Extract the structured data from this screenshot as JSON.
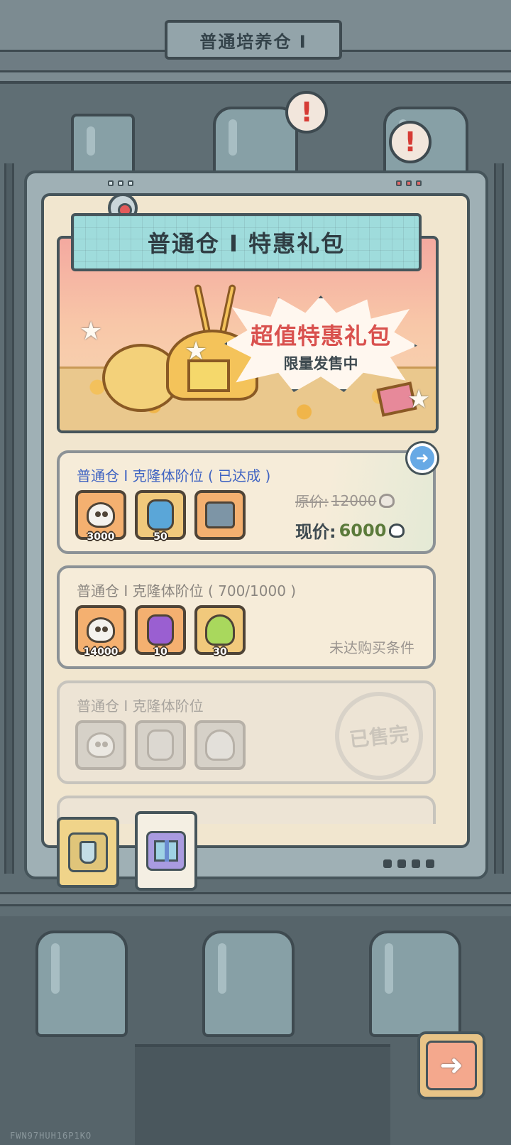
{
  "background": {
    "title": "普通培养仓 I",
    "alert_glyph": "!",
    "watermark": "FWN97HUH16P1KO"
  },
  "panel": {
    "title": "普通仓 I 特惠礼包",
    "hero": {
      "headline": "超值特惠礼包",
      "subline": "限量发售中"
    }
  },
  "packs": [
    {
      "title": "普通仓 I 克隆体阶位 ( 已达成 )",
      "state": "available",
      "items": [
        {
          "icon": "ghost-currency-icon",
          "count": "3000"
        },
        {
          "icon": "blue-potion-jar-icon",
          "count": "50"
        },
        {
          "icon": "robot-machine-icon",
          "count": ""
        }
      ],
      "original_price_label": "原价:",
      "original_price": "12000",
      "current_price_label": "现价:",
      "current_price": "6000",
      "arrow_glyph": "➜"
    },
    {
      "title": "普通仓 I 克隆体阶位 ( 700/1000 )",
      "state": "locked",
      "items": [
        {
          "icon": "ghost-currency-icon",
          "count": "14000"
        },
        {
          "icon": "purple-potion-jar-icon",
          "count": "10"
        },
        {
          "icon": "green-creature-icon",
          "count": "30"
        }
      ],
      "status": "未达购买条件"
    },
    {
      "title": "普通仓 I 克隆体阶位",
      "state": "sold-out",
      "items": [
        {
          "icon": "ghost-currency-icon",
          "count": ""
        },
        {
          "icon": "potion-jar-icon",
          "count": ""
        },
        {
          "icon": "creature-icon",
          "count": ""
        }
      ],
      "status": "已售完"
    }
  ],
  "tabs": [
    {
      "name": "clone-tab",
      "icon": "flask-icon",
      "active": false
    },
    {
      "name": "gift-pack-tab",
      "icon": "gift-box-icon",
      "active": true
    }
  ],
  "next_button": {
    "glyph": "➜"
  },
  "colors": {
    "active_title": "#3f63c2",
    "price_accent": "#5b7a3a",
    "burst_title": "#d9514e"
  }
}
